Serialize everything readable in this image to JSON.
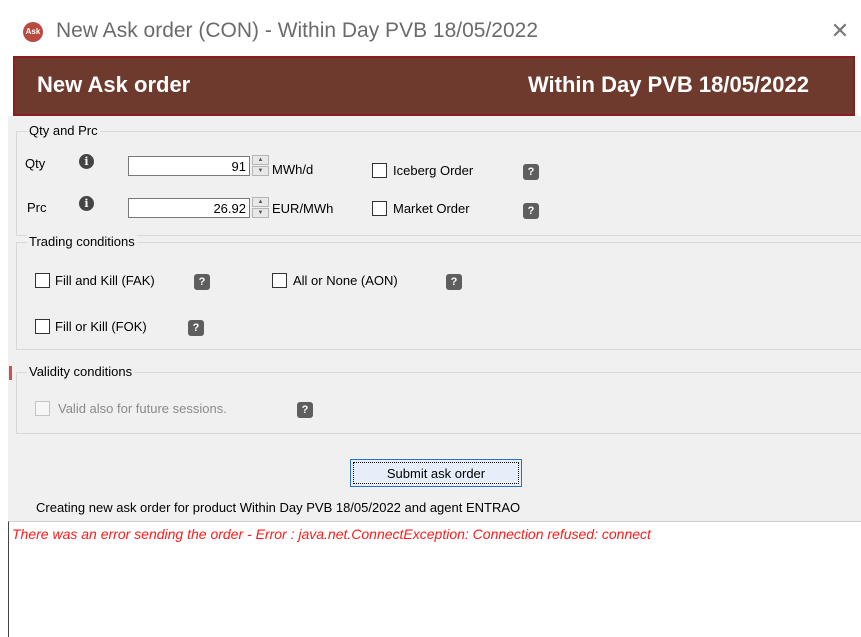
{
  "window": {
    "title": "New Ask order (CON)  -  Within Day PVB 18/05/2022",
    "app_icon_label": "Ask",
    "close_glyph": "✕"
  },
  "header": {
    "left": "New Ask order",
    "right": "Within Day PVB 18/05/2022",
    "background_color": "#6e3a2d"
  },
  "qty_prc": {
    "group_label": "Qty and Prc",
    "qty": {
      "label": "Qty",
      "value": "91",
      "unit": "MWh/d"
    },
    "prc": {
      "label": "Prc",
      "value": "26.92",
      "unit": "EUR/MWh"
    },
    "iceberg_order": "Iceberg Order",
    "market_order": "Market Order"
  },
  "trading": {
    "group_label": "Trading conditions",
    "fak": "Fill and Kill (FAK)",
    "aon": "All or None (AON)",
    "fok": "Fill or Kill (FOK)"
  },
  "validity": {
    "group_label": "Validity conditions",
    "future_sessions": "Valid also for future sessions."
  },
  "icons": {
    "info": "i",
    "help": "?",
    "spin_up": "▲",
    "spin_down": "▼"
  },
  "submit_label": "Submit ask order",
  "status": "Creating new ask order for product Within Day PVB 18/05/2022 and agent ENTRAO",
  "error": {
    "text": "There was an error sending the order - Error : java.net.ConnectException: Connection refused: connect",
    "color": "#ff1b1b"
  }
}
